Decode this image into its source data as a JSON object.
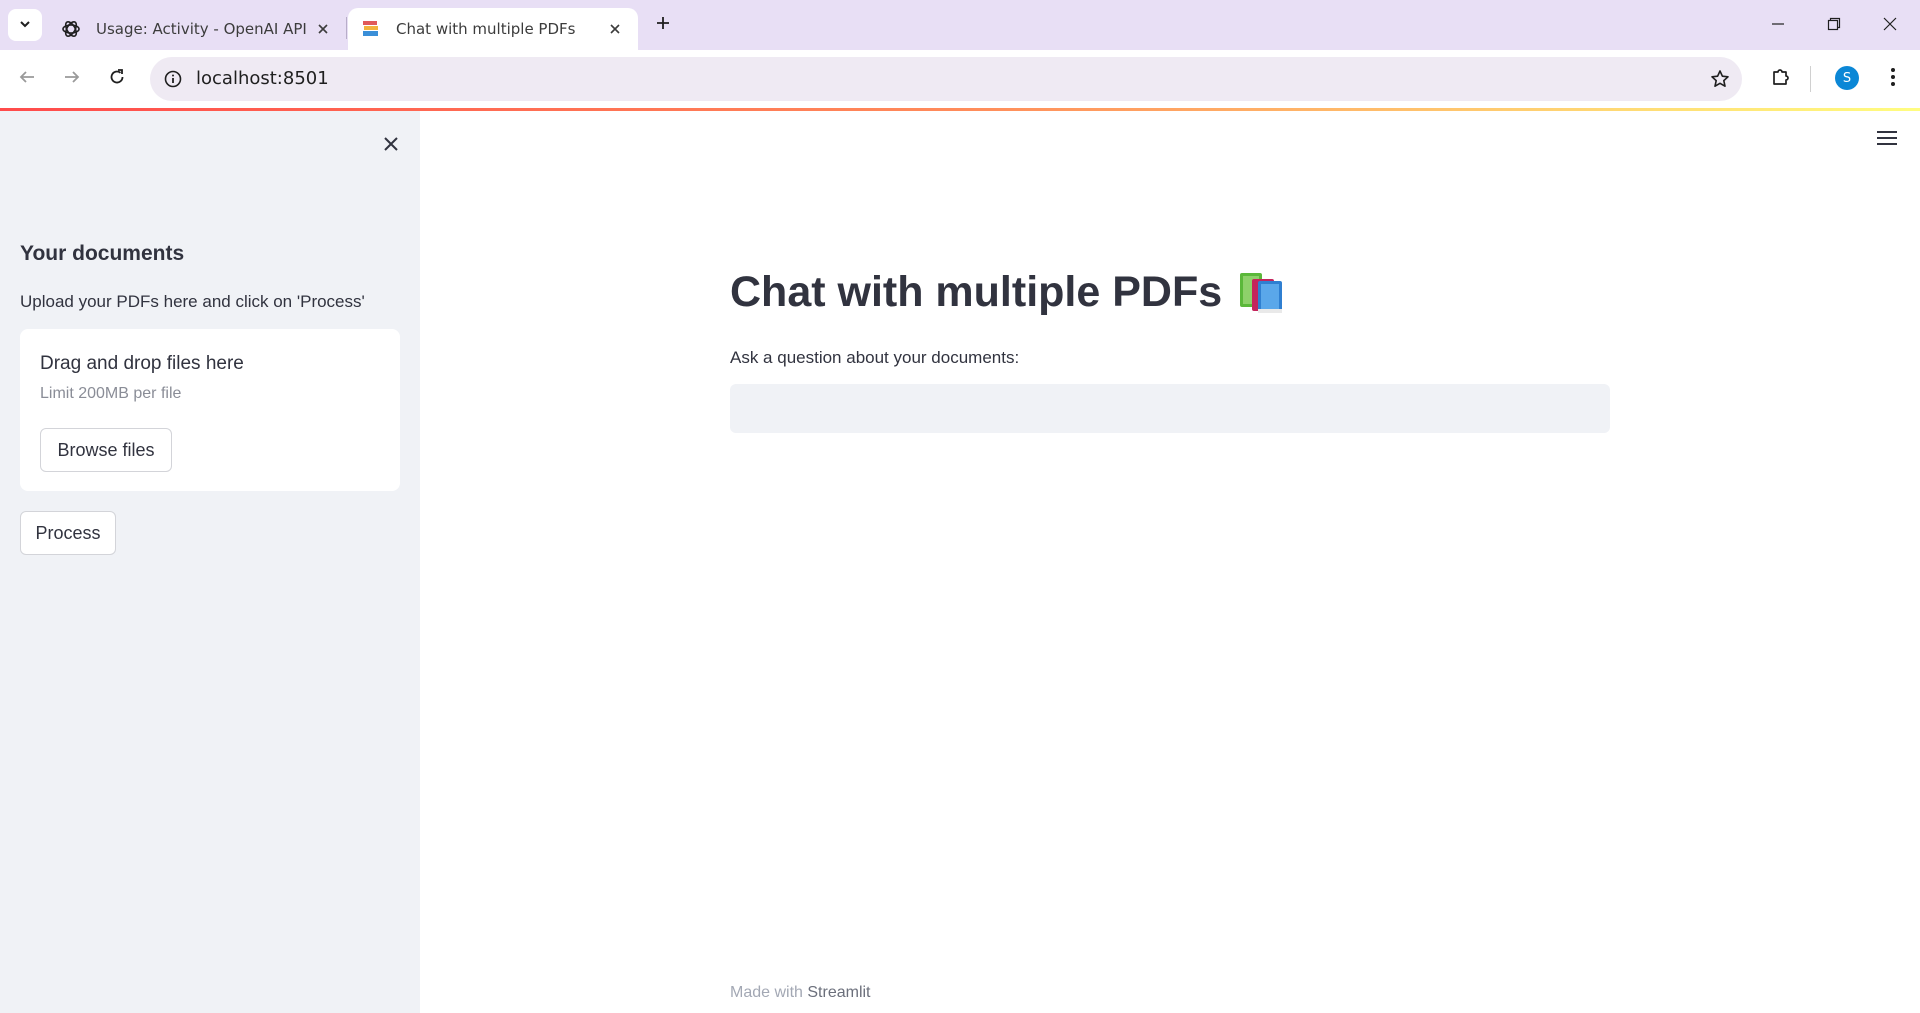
{
  "browser": {
    "tabs": [
      {
        "title": "Usage: Activity - OpenAI API",
        "favicon": "openai-icon",
        "active": false
      },
      {
        "title": "Chat with multiple PDFs",
        "favicon": "books-icon",
        "active": true
      }
    ],
    "url": "localhost:8501",
    "profile_initial": "S",
    "profile_color": "#0b87d6"
  },
  "sidebar": {
    "header": "Your documents",
    "instructions": "Upload your PDFs here and click on 'Process'",
    "uploader": {
      "title": "Drag and drop files here",
      "limit": "Limit 200MB per file",
      "browse_label": "Browse files"
    },
    "process_label": "Process"
  },
  "main": {
    "title": "Chat with multiple PDFs",
    "title_emoji": "books-icon",
    "question_label": "Ask a question about your documents:",
    "question_value": "",
    "question_placeholder": ""
  },
  "footer": {
    "prefix": "Made with",
    "brand": "Streamlit"
  },
  "colors": {
    "accent": "#ff4b4b",
    "sidebar_bg": "#f0f2f6",
    "text": "#31333f",
    "tabbar_bg": "#e8dff5"
  }
}
